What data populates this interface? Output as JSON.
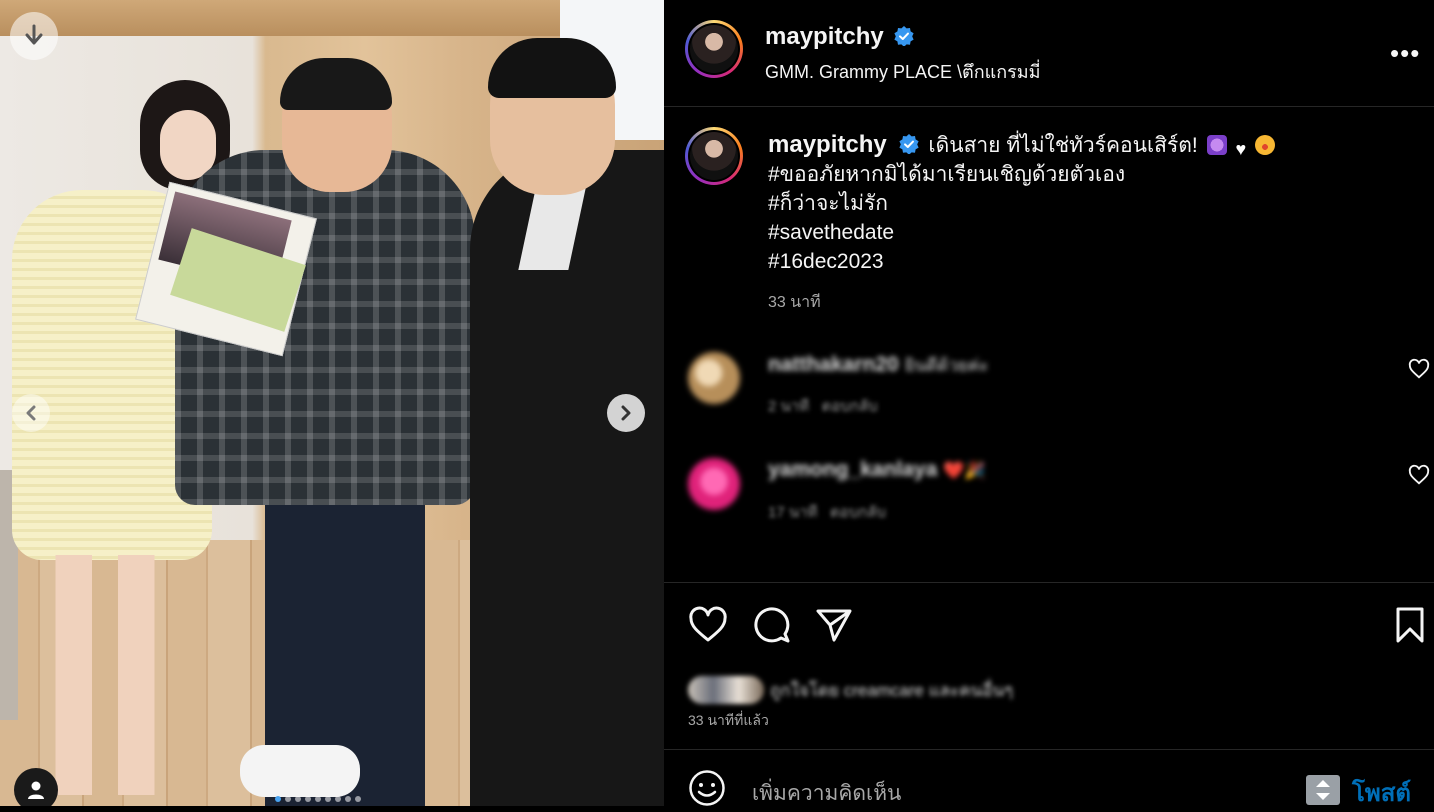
{
  "post": {
    "username": "maypitchy",
    "location": "GMM. Grammy PLACE \\ตึกแกรมมี่",
    "more_icon": "more-horizontal-icon",
    "verified_color": "#3797f0"
  },
  "photo": {
    "carousel_total": 9,
    "carousel_active": 1
  },
  "caption": {
    "username": "maypitchy",
    "lines": [
      "เดินสาย ที่ไม่ใช่ทัวร์คอนเสิร์ต!",
      "#ขออภัยหากมิได้มาเรียนเชิญด้วยตัวเอง",
      "#ก็ว่าจะไม่รัก",
      "#savethedate",
      "#16dec2023"
    ],
    "time": "33 นาที"
  },
  "comments": [
    {
      "username": "natthakarn20",
      "text": "ยินดีด้วยค่ะ",
      "time": "2 นาที",
      "reply": "ตอบกลับ",
      "avatar_color": "#b78f5a"
    },
    {
      "username": "yamong_kanlaya",
      "text": "❤️🎉",
      "time": "17 นาที",
      "reply": "ตอบกลับ",
      "avatar_color": "#e0227a"
    }
  ],
  "likes": {
    "text": "ถูกใจโดย creamcare และคนอื่นๆ",
    "time": "33 นาทีที่แล้ว"
  },
  "comment_box": {
    "placeholder": "เพิ่มความคิดเห็น",
    "post_label": "โพสต์"
  },
  "colors": {
    "background": "#000000",
    "accent": "#0095f6",
    "divider": "#262626"
  }
}
